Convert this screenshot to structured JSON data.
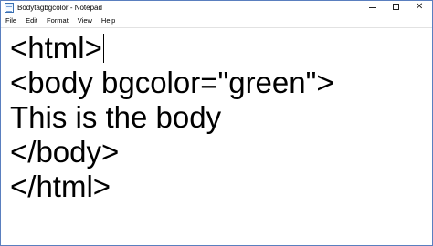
{
  "window": {
    "title": "Bodytagbgcolor - Notepad",
    "app_icon": "notepad-icon",
    "controls": {
      "minimize_icon": "minimize-icon",
      "maximize_icon": "maximize-icon",
      "close_icon": "close-icon",
      "close_glyph": "✕"
    }
  },
  "menu": {
    "items": [
      {
        "label": "File"
      },
      {
        "label": "Edit"
      },
      {
        "label": "Format"
      },
      {
        "label": "View"
      },
      {
        "label": "Help"
      }
    ]
  },
  "editor": {
    "lines": [
      "<html>",
      "<body bgcolor=\"green\">",
      "This is the body",
      "</body>",
      "</html>"
    ]
  }
}
